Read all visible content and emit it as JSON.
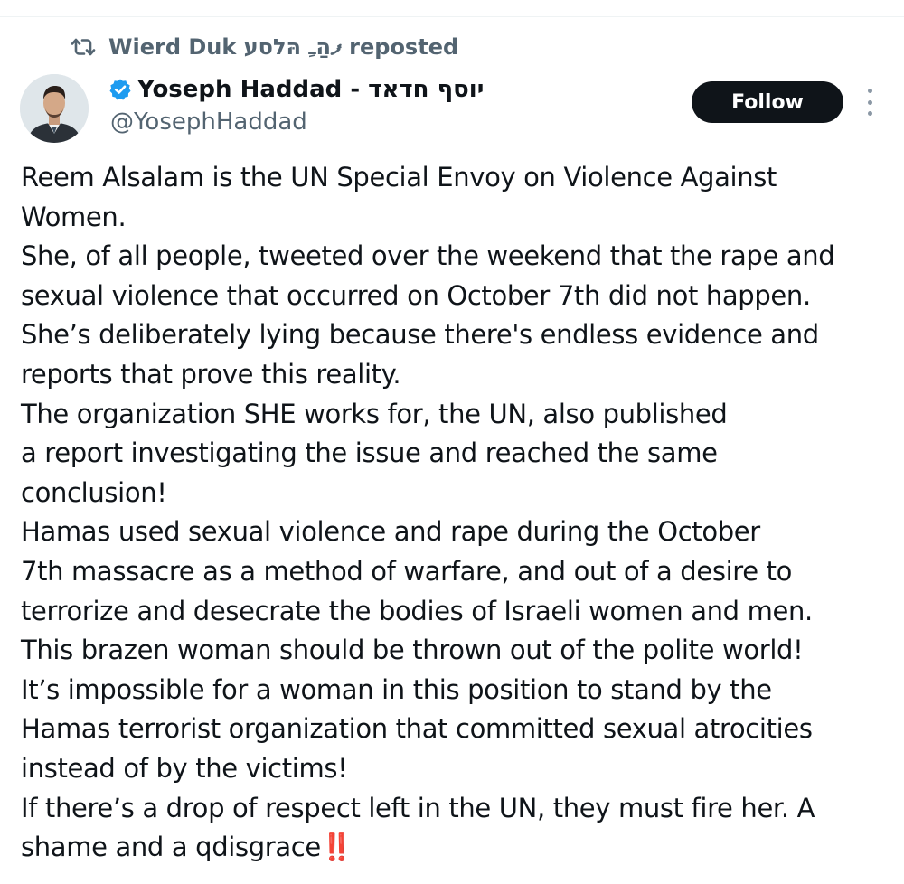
{
  "repost": {
    "icon": "repost-icon",
    "text": "Wierd Duk ފהַﹻ הּלסע reposted"
  },
  "author": {
    "avatar_icon": "avatar-portrait",
    "verified_icon": "verified-badge-icon",
    "name": "Yoseph Haddad - יוסף חדאד",
    "handle": "@YosephHaddad",
    "verified_color": "#1d9bf0"
  },
  "actions": {
    "follow_label": "Follow",
    "more_icon": "more-options-icon"
  },
  "tweet": {
    "lines": [
      "Reem Alsalam is the UN Special Envoy on Violence Against",
      "Women.",
      "She, of all people, tweeted over the weekend that the rape and",
      "sexual violence that occurred on October 7th did not happen.",
      "She’s deliberately lying because there's endless evidence and",
      "reports that prove this reality.",
      "The organization SHE works for, the UN, also published",
      "a report investigating the issue and reached the same",
      "conclusion!",
      "Hamas used sexual violence and rape during the October",
      "7th massacre as a method of warfare, and out of a desire to",
      "terrorize and desecrate the bodies of Israeli women and men.",
      "This brazen woman should be thrown out of the polite world!",
      "It’s impossible for a woman in this position to stand by the",
      "Hamas terrorist organization that committed sexual atrocities",
      "instead of by the victims!",
      "If there’s a drop of respect left in the UN, they must fire her. A",
      "shame and a qdisgrace"
    ],
    "emoji": "‼️"
  },
  "colors": {
    "text": "#0f1419",
    "secondary": "#536471",
    "follow_bg": "#0f1419",
    "follow_text": "#ffffff",
    "emoji": "#e0245e"
  }
}
